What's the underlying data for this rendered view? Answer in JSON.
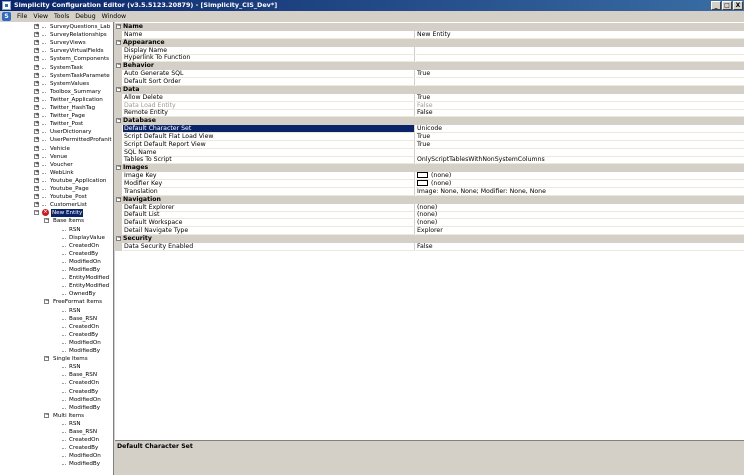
{
  "window": {
    "title": "Simplicity Configuration Editor (v3.5.5123.20879) - [Simplicity_CIS_Dev*]",
    "buttons": [
      "_",
      "□",
      "X"
    ]
  },
  "menu": [
    "File",
    "View",
    "Tools",
    "Debug",
    "Window"
  ],
  "tree": {
    "top_nodes": [
      "SurveyQuestions_Lab",
      "SurveyRelationships",
      "SurveyViews",
      "SurveyVirtualFields",
      "System_Components",
      "SystemTask",
      "SystemTaskParamete",
      "SystemValues",
      "Toolbox_Summary",
      "Twitter_Application",
      "Twitter_HashTag",
      "Twitter_Page",
      "Twitter_Post",
      "UserDictionary",
      "UserPermittedProfanit",
      "Vehicle",
      "Venue",
      "Voucher",
      "WebLink",
      "Youtube_Application",
      "Youtube_Page",
      "Youtube_Post",
      "CustomerList"
    ],
    "selected_node": "New Entity",
    "groups": [
      {
        "label": "Base Items",
        "children": [
          "RSN",
          "DisplayValue",
          "CreatedOn",
          "CreatedBy",
          "ModifiedOn",
          "ModifiedBy",
          "EntityModified",
          "EntityModified",
          "OwnedBy"
        ]
      },
      {
        "label": "FreeFormat Items",
        "children": [
          "RSN",
          "Base_RSN",
          "CreatedOn",
          "CreatedBy",
          "ModifiedOn",
          "ModifiedBy"
        ]
      },
      {
        "label": "Single Items",
        "children": [
          "RSN",
          "Base_RSN",
          "CreatedOn",
          "CreatedBy",
          "ModifiedOn",
          "ModifiedBy"
        ]
      },
      {
        "label": "Multi Items",
        "children": [
          "RSN",
          "Base_RSN",
          "CreatedOn",
          "CreatedBy",
          "ModifiedOn",
          "ModifiedBy"
        ]
      }
    ]
  },
  "properties": [
    {
      "category": "Name",
      "items": [
        {
          "name": "Name",
          "value": "New Entity"
        }
      ]
    },
    {
      "category": "Appearance",
      "items": [
        {
          "name": "Display Name",
          "value": ""
        },
        {
          "name": "Hyperlink To Function",
          "value": ""
        }
      ]
    },
    {
      "category": "Behavior",
      "items": [
        {
          "name": "Auto Generate SQL",
          "value": "True"
        },
        {
          "name": "Default Sort Order",
          "value": ""
        }
      ]
    },
    {
      "category": "Data",
      "items": [
        {
          "name": "Allow Delete",
          "value": "True"
        },
        {
          "name": "Data Load Entity",
          "value": "False",
          "disabled": true
        },
        {
          "name": "Remote Entity",
          "value": "False"
        }
      ]
    },
    {
      "category": "Database",
      "items": [
        {
          "name": "Default Character Set",
          "value": "Unicode",
          "selected": true
        },
        {
          "name": "Script Default Flat Load View",
          "value": "True"
        },
        {
          "name": "Script Default Report View",
          "value": "True"
        },
        {
          "name": "SQL Name",
          "value": ""
        },
        {
          "name": "Tables To Script",
          "value": "OnlyScriptTablesWithNonSystemColumns"
        }
      ]
    },
    {
      "category": "Images",
      "items": [
        {
          "name": "Image Key",
          "value": "(none)",
          "swatch": true
        },
        {
          "name": "Modifier Key",
          "value": "(none)",
          "swatch": true
        },
        {
          "name": "Translation",
          "value": "Image: None, None; Modifier: None, None"
        }
      ]
    },
    {
      "category": "Navigation",
      "items": [
        {
          "name": "Default Explorer",
          "value": "(none)"
        },
        {
          "name": "Default List",
          "value": "(none)"
        },
        {
          "name": "Default Workspace",
          "value": "(none)"
        },
        {
          "name": "Detail Navigate Type",
          "value": "Explorer"
        }
      ]
    },
    {
      "category": "Security",
      "items": [
        {
          "name": "Data Security Enabled",
          "value": "False"
        }
      ]
    }
  ],
  "help": {
    "title": "Default Character Set"
  }
}
